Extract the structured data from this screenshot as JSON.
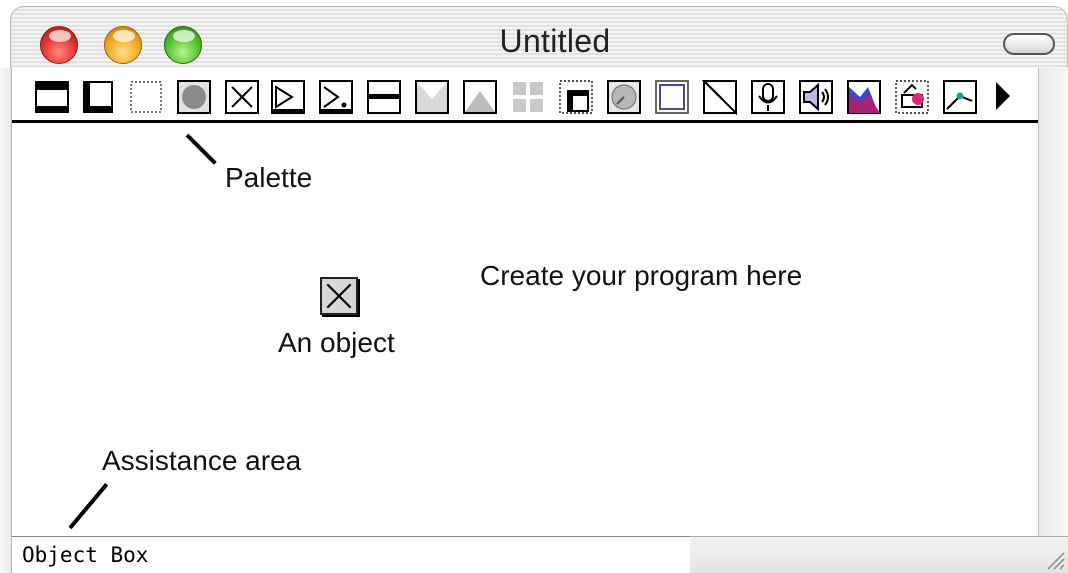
{
  "window": {
    "title": "Untitled"
  },
  "palette": {
    "label": "Palette",
    "tools": [
      "text-frame-tool",
      "text-tool",
      "rectangle-tool",
      "button-tool",
      "checkbox-tool",
      "popup-tool",
      "popup-pointer-tool",
      "line-tool",
      "triangle-down-tool",
      "triangle-up-tool",
      "grid-tool",
      "shadow-box-tool",
      "dial-tool",
      "window-frame-tool",
      "chart-tool",
      "microphone-tool",
      "speaker-tool",
      "graph-tool",
      "sprite-tool",
      "pen-tool"
    ],
    "more_icon": "triangle-right-icon"
  },
  "canvas": {
    "create_hint": "Create your program here",
    "object_label": "An object",
    "assistance_label": "Assistance area"
  },
  "status": {
    "object_box": "Object Box"
  }
}
